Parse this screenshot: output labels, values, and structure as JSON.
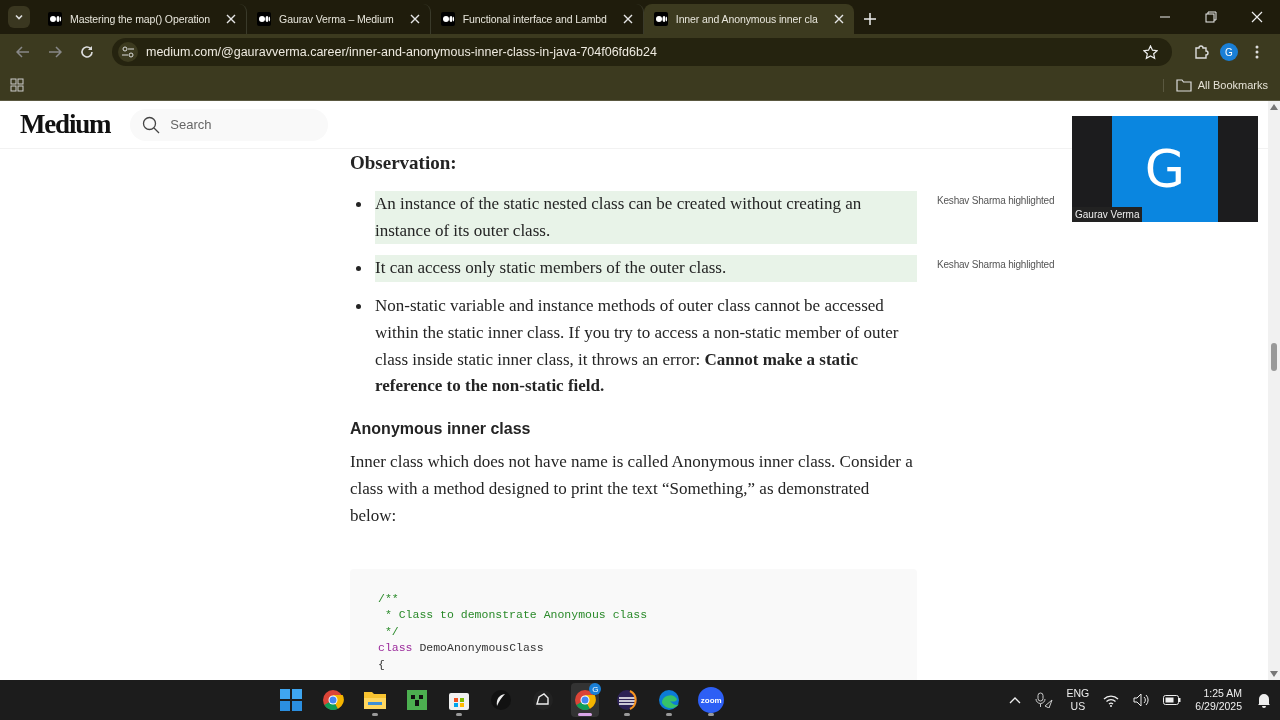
{
  "browser": {
    "tabs": [
      {
        "title": "Mastering the map() Operation",
        "selected": false
      },
      {
        "title": "Gaurav Verma – Medium",
        "selected": false
      },
      {
        "title": "Functional interface and Lambd",
        "selected": false
      },
      {
        "title": "Inner and Anonymous inner cla",
        "selected": true
      }
    ],
    "address": "medium.com/@gauravverma.career/inner-and-anonymous-inner-class-in-java-704f06fd6b24",
    "profile_initial": "G",
    "bookmarks_label": "All Bookmarks"
  },
  "site_header": {
    "logo": "Medium",
    "search": {
      "placeholder": "Search"
    }
  },
  "article": {
    "section_label": "Observation:",
    "bullets": [
      {
        "text": "An instance of the static nested class can be created without creating an instance of its outer class.",
        "highlighted": true,
        "note": "Keshav Sharma highlighted"
      },
      {
        "text": "It can access only static members of the outer class.",
        "highlighted": true,
        "note": "Keshav Sharma highlighted"
      },
      {
        "text": "Non-static variable and instance methods of outer class cannot be accessed within the static inner class. If you try to access a non-static member of outer class inside static inner class, it throws an error: **Cannot make a static reference to the non-static field.**",
        "highlighted": false
      }
    ],
    "heading": "Anonymous inner class",
    "paragraph": "Inner class which does not have name is called Anonymous inner class. Consider a class with a method designed to print the text “Something,” as demonstrated below:",
    "code": [
      {
        "kind": "comment",
        "text": "/**"
      },
      {
        "kind": "comment",
        "text": " * Class to demonstrate Anonymous class"
      },
      {
        "kind": "comment",
        "text": " */"
      },
      {
        "kind": "declaration",
        "keyword": "class",
        "text": "DemoAnonymousClass"
      },
      {
        "kind": "plain",
        "text": "{"
      }
    ]
  },
  "video_tile": {
    "initial": "G",
    "name": "Gaurav Verma"
  },
  "taskbar": {
    "apps": [
      {
        "kind": "windows",
        "running": false,
        "selected": false
      },
      {
        "kind": "chrome",
        "running": false,
        "selected": false
      },
      {
        "kind": "files",
        "running": true,
        "selected": false
      },
      {
        "kind": "minecraft",
        "running": false,
        "selected": false
      },
      {
        "kind": "store",
        "running": true,
        "selected": false
      },
      {
        "kind": "quill",
        "running": false,
        "selected": false
      },
      {
        "kind": "hat",
        "running": false,
        "selected": false
      },
      {
        "kind": "chrome",
        "running": true,
        "selected": true,
        "badge": "G"
      },
      {
        "kind": "eclipse",
        "running": true,
        "selected": false
      },
      {
        "kind": "edge",
        "running": true,
        "selected": false
      },
      {
        "kind": "zoom",
        "running": true,
        "selected": false,
        "label": "zoom"
      }
    ],
    "language": [
      "ENG",
      "US"
    ],
    "time": "1:25 AM",
    "date": "6/29/2025"
  }
}
